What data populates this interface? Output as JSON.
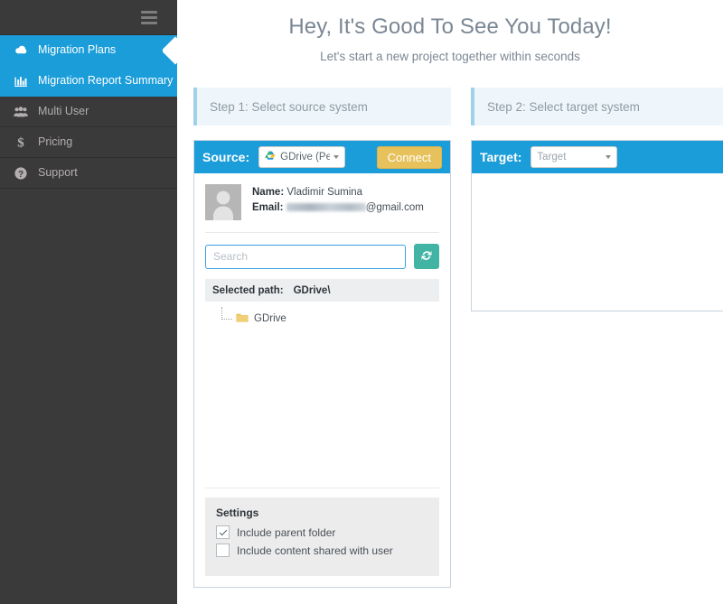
{
  "sidebar": {
    "menu_icon": "hamburger-icon",
    "items": [
      {
        "label": "Migration Plans",
        "icon": "cloud-icon",
        "active": true
      },
      {
        "label": "Migration Report Summary",
        "icon": "bar-chart-icon",
        "active": true
      },
      {
        "label": "Multi User",
        "icon": "users-icon",
        "active": false
      },
      {
        "label": "Pricing",
        "icon": "dollar-icon",
        "active": false
      },
      {
        "label": "Support",
        "icon": "question-circle-icon",
        "active": false
      }
    ]
  },
  "header": {
    "title": "Hey, It's Good To See You Today!",
    "subtitle": "Let's start a new project together within seconds"
  },
  "source": {
    "step_header": "Step 1: Select source system",
    "bar_label": "Source:",
    "system_value": "GDrive (Pe",
    "system_icon": "gdrive-icon",
    "connect_label": "Connect",
    "user": {
      "avatar": "avatar-placeholder-icon",
      "name_label": "Name:",
      "name_value": "Vladimir Sumina",
      "email_label": "Email:",
      "email_value": "@gmail.com",
      "email_redacted": true
    },
    "search": {
      "placeholder": "Search",
      "value": "",
      "refresh_icon": "refresh-icon"
    },
    "selected_path_label": "Selected path:",
    "selected_path_value": "GDrive\\",
    "tree": [
      {
        "label": "GDrive",
        "icon": "folder-icon"
      }
    ],
    "settings": {
      "title": "Settings",
      "options": [
        {
          "label": "Include parent folder",
          "checked": true
        },
        {
          "label": "Include content shared with user",
          "checked": false
        }
      ]
    }
  },
  "target": {
    "step_header": "Step 2: Select target system",
    "bar_label": "Target:",
    "system_value": "Target"
  },
  "colors": {
    "accent_blue": "#1b9dd9",
    "sidebar_dark": "#3a3a3a",
    "connect_gold": "#e6c15c",
    "refresh_teal": "#42b4a4",
    "step_bg": "#eef6fb",
    "step_accent": "#9ed2ea",
    "folder_yellow": "#e8c15c"
  }
}
